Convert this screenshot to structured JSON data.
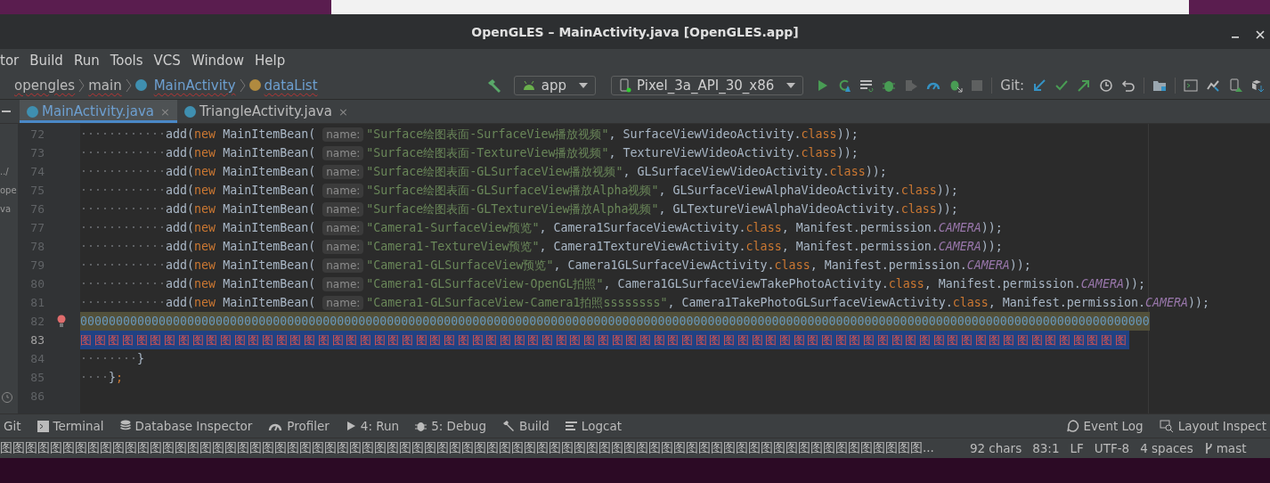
{
  "window": {
    "title": "OpenGLES – MainActivity.java [OpenGLES.app]"
  },
  "menu": [
    "tor",
    "Build",
    "Run",
    "Tools",
    "VCS",
    "Window",
    "Help"
  ],
  "breadcrumbs": [
    {
      "label": "opengles",
      "kind": "folder"
    },
    {
      "label": "main",
      "kind": "folder"
    },
    {
      "label": "MainActivity",
      "kind": "class"
    },
    {
      "label": "dataList",
      "kind": "field"
    }
  ],
  "toolbar": {
    "run_config": "app",
    "device": "Pixel_3a_API_30_x86",
    "git_label": "Git:"
  },
  "tabs": [
    {
      "label": "MainActivity.java",
      "selected": true,
      "close": "×"
    },
    {
      "label": "TriangleActivity.java",
      "selected": false,
      "close": "×"
    }
  ],
  "project_fragments": [
    "../",
    "ope",
    "va"
  ],
  "editor": {
    "lines": [
      {
        "number": "72",
        "segments": [
          {
            "kind": "ws",
            "text": "············"
          },
          {
            "kind": "plain",
            "text": "add("
          },
          {
            "kind": "kw",
            "text": "new"
          },
          {
            "kind": "plain",
            "text": " MainItemBean( "
          },
          {
            "kind": "hint",
            "text": "name:"
          },
          {
            "kind": "str",
            "text": "\"Surface绘图表面-SurfaceView播放视频\""
          },
          {
            "kind": "plain",
            "text": ", SurfaceViewVideoActivity."
          },
          {
            "kind": "kw",
            "text": "class"
          },
          {
            "kind": "plain",
            "text": "));"
          }
        ]
      },
      {
        "number": "73",
        "segments": [
          {
            "kind": "ws",
            "text": "············"
          },
          {
            "kind": "plain",
            "text": "add("
          },
          {
            "kind": "kw",
            "text": "new"
          },
          {
            "kind": "plain",
            "text": " MainItemBean( "
          },
          {
            "kind": "hint",
            "text": "name:"
          },
          {
            "kind": "str",
            "text": "\"Surface绘图表面-TextureView播放视频\""
          },
          {
            "kind": "plain",
            "text": ", TextureViewVideoActivity."
          },
          {
            "kind": "kw",
            "text": "class"
          },
          {
            "kind": "plain",
            "text": "));"
          }
        ]
      },
      {
        "number": "74",
        "segments": [
          {
            "kind": "ws",
            "text": "············"
          },
          {
            "kind": "plain",
            "text": "add("
          },
          {
            "kind": "kw",
            "text": "new"
          },
          {
            "kind": "plain",
            "text": " MainItemBean( "
          },
          {
            "kind": "hint",
            "text": "name:"
          },
          {
            "kind": "str",
            "text": "\"Surface绘图表面-GLSurfaceView播放视频\""
          },
          {
            "kind": "plain",
            "text": ", GLSurfaceViewVideoActivity."
          },
          {
            "kind": "kw",
            "text": "class"
          },
          {
            "kind": "plain",
            "text": "));"
          }
        ]
      },
      {
        "number": "75",
        "segments": [
          {
            "kind": "ws",
            "text": "············"
          },
          {
            "kind": "plain",
            "text": "add("
          },
          {
            "kind": "kw",
            "text": "new"
          },
          {
            "kind": "plain",
            "text": " MainItemBean( "
          },
          {
            "kind": "hint",
            "text": "name:"
          },
          {
            "kind": "str",
            "text": "\"Surface绘图表面-GLSurfaceView播放Alpha视频\""
          },
          {
            "kind": "plain",
            "text": ", GLSurfaceViewAlphaVideoActivity."
          },
          {
            "kind": "kw",
            "text": "class"
          },
          {
            "kind": "plain",
            "text": "));"
          }
        ]
      },
      {
        "number": "76",
        "segments": [
          {
            "kind": "ws",
            "text": "············"
          },
          {
            "kind": "plain",
            "text": "add("
          },
          {
            "kind": "kw",
            "text": "new"
          },
          {
            "kind": "plain",
            "text": " MainItemBean( "
          },
          {
            "kind": "hint",
            "text": "name:"
          },
          {
            "kind": "str",
            "text": "\"Surface绘图表面-GLTextureView播放Alpha视频\""
          },
          {
            "kind": "plain",
            "text": ", GLTextureViewAlphaVideoActivity."
          },
          {
            "kind": "kw",
            "text": "class"
          },
          {
            "kind": "plain",
            "text": "));"
          }
        ]
      },
      {
        "number": "77",
        "segments": [
          {
            "kind": "ws",
            "text": "············"
          },
          {
            "kind": "plain",
            "text": "add("
          },
          {
            "kind": "kw",
            "text": "new"
          },
          {
            "kind": "plain",
            "text": " MainItemBean( "
          },
          {
            "kind": "hint",
            "text": "name:"
          },
          {
            "kind": "str",
            "text": "\"Camera1-SurfaceView预览\""
          },
          {
            "kind": "plain",
            "text": ", Camera1SurfaceViewActivity."
          },
          {
            "kind": "kw",
            "text": "class"
          },
          {
            "kind": "plain",
            "text": ", Manifest.permission."
          },
          {
            "kind": "const",
            "text": "CAMERA"
          },
          {
            "kind": "plain",
            "text": "));"
          }
        ]
      },
      {
        "number": "78",
        "segments": [
          {
            "kind": "ws",
            "text": "············"
          },
          {
            "kind": "plain",
            "text": "add("
          },
          {
            "kind": "kw",
            "text": "new"
          },
          {
            "kind": "plain",
            "text": " MainItemBean( "
          },
          {
            "kind": "hint",
            "text": "name:"
          },
          {
            "kind": "str",
            "text": "\"Camera1-TextureView预览\""
          },
          {
            "kind": "plain",
            "text": ", Camera1TextureViewActivity."
          },
          {
            "kind": "kw",
            "text": "class"
          },
          {
            "kind": "plain",
            "text": ", Manifest.permission."
          },
          {
            "kind": "const",
            "text": "CAMERA"
          },
          {
            "kind": "plain",
            "text": "));"
          }
        ]
      },
      {
        "number": "79",
        "segments": [
          {
            "kind": "ws",
            "text": "············"
          },
          {
            "kind": "plain",
            "text": "add("
          },
          {
            "kind": "kw",
            "text": "new"
          },
          {
            "kind": "plain",
            "text": " MainItemBean( "
          },
          {
            "kind": "hint",
            "text": "name:"
          },
          {
            "kind": "str",
            "text": "\"Camera1-GLSurfaceView预览\""
          },
          {
            "kind": "plain",
            "text": ", Camera1GLSurfaceViewActivity."
          },
          {
            "kind": "kw",
            "text": "class"
          },
          {
            "kind": "plain",
            "text": ", Manifest.permission."
          },
          {
            "kind": "const",
            "text": "CAMERA"
          },
          {
            "kind": "plain",
            "text": "));"
          }
        ]
      },
      {
        "number": "80",
        "segments": [
          {
            "kind": "ws",
            "text": "············"
          },
          {
            "kind": "plain",
            "text": "add("
          },
          {
            "kind": "kw",
            "text": "new"
          },
          {
            "kind": "plain",
            "text": " MainItemBean( "
          },
          {
            "kind": "hint",
            "text": "name:"
          },
          {
            "kind": "str",
            "text": "\"Camera1-GLSurfaceView-OpenGL拍照\""
          },
          {
            "kind": "plain",
            "text": ", Camera1GLSurfaceViewTakePhotoActivity."
          },
          {
            "kind": "kw",
            "text": "class"
          },
          {
            "kind": "plain",
            "text": ", Manifest.permission."
          },
          {
            "kind": "const",
            "text": "CAMERA"
          },
          {
            "kind": "plain",
            "text": "));"
          }
        ]
      },
      {
        "number": "81",
        "segments": [
          {
            "kind": "ws",
            "text": "············"
          },
          {
            "kind": "plain",
            "text": "add("
          },
          {
            "kind": "kw",
            "text": "new"
          },
          {
            "kind": "plain",
            "text": " MainItemBean( "
          },
          {
            "kind": "hint",
            "text": "name:"
          },
          {
            "kind": "str",
            "text": "\"Camera1-GLSurfaceView-Camera1拍照ssssssss\""
          },
          {
            "kind": "plain",
            "text": ", Camera1TakePhotoGLSurfaceViewActivity."
          },
          {
            "kind": "kw",
            "text": "class"
          },
          {
            "kind": "plain",
            "text": ", Manifest.permission."
          },
          {
            "kind": "const",
            "text": "CAMERA"
          },
          {
            "kind": "plain",
            "text": "));"
          }
        ]
      },
      {
        "number": "82",
        "kind": "warning",
        "segments": [
          {
            "kind": "num",
            "text": "000000000000000000000000000000000000000000000000000000000000000000000000000000000000000000000000000000000000000000000000000000000000000000000000000000"
          }
        ]
      },
      {
        "number": "83",
        "kind": "selection",
        "segments": [
          {
            "kind": "err",
            "text": "图图图图图图图图图图图图图图图图图图图图图图图图图图图图图图图图图图图图图图图图图图图图图图图图图图图图图图图图图图图图图图图图图图图图图图图图图图图"
          }
        ]
      },
      {
        "number": "84",
        "segments": [
          {
            "kind": "ws",
            "text": "········"
          },
          {
            "kind": "plain",
            "text": "}"
          }
        ]
      },
      {
        "number": "85",
        "segments": [
          {
            "kind": "ws",
            "text": "····"
          },
          {
            "kind": "plain",
            "text": "}"
          },
          {
            "kind": "kw",
            "text": ";"
          }
        ]
      },
      {
        "number": "86"
      }
    ]
  },
  "tool_windows": {
    "left": [
      "Git",
      "Terminal",
      "Database Inspector",
      "Profiler",
      "4: Run",
      "5: Debug",
      "Build",
      "Logcat"
    ],
    "right": [
      "Event Log",
      "Layout Inspect"
    ]
  },
  "status_bar": {
    "message": "图图图图图图图图图图图图图图图图图图图图图图图图图图图图图图图图图图图图图图图图图图图图图图图图图图图图图图图图图图图图图图图图图图图图图图图图图图...",
    "items": [
      "92 chars",
      "83:1",
      "LF",
      "UTF-8",
      "4 spaces"
    ],
    "branch": "mast"
  }
}
